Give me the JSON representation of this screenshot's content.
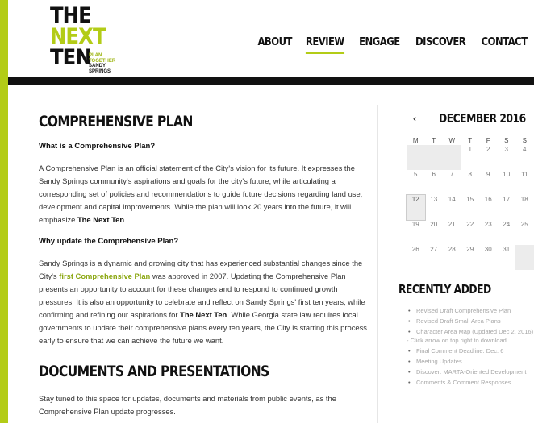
{
  "logo": {
    "line1": "THE",
    "line2": "NEXT",
    "line3": "TEN",
    "tag1": "PLAN",
    "tag2": "TOGETHER",
    "tag3": "SANDY",
    "tag4": "SPRINGS"
  },
  "nav": {
    "items": [
      {
        "label": "ABOUT"
      },
      {
        "label": "REVIEW",
        "active": true
      },
      {
        "label": "ENGAGE"
      },
      {
        "label": "DISCOVER"
      },
      {
        "label": "CONTACT"
      }
    ]
  },
  "main": {
    "title": "COMPREHENSIVE PLAN",
    "q1": "What is a Comprehensive Plan?",
    "p1_a": "A Comprehensive Plan is an official statement of the City's vision for its future. It expresses the Sandy Springs community's aspirations and goals for the city's future, while articulating a corresponding set of policies and recommendations to guide future decisions regarding land use, development and capital improvements. While the plan will look 20 years into the future, it will emphasize ",
    "p1_bold": "The Next Ten",
    "p1_end": ".",
    "q2": "Why update the Comprehensive Plan?",
    "p2_a": "Sandy Springs is a dynamic and growing city that has experienced substantial changes since the City's ",
    "p2_link": "first Comprehensive Plan",
    "p2_b": " was approved in 2007. Updating the Comprehensive Plan presents an opportunity to account for these changes and to respond to continued growth pressures. It is also an opportunity to celebrate and reflect on Sandy Springs' first ten years, while confirming and refining our aspirations for ",
    "p2_bold": "The Next Ten",
    "p2_c": ". While Georgia state law requires local governments to update their comprehensive plans every ten years, the City is starting this process early to ensure that we can achieve the future we want.",
    "title2": "DOCUMENTS AND PRESENTATIONS",
    "p3": "Stay tuned to this space for updates, documents and materials from public events, as the Comprehensive Plan update progresses."
  },
  "calendar": {
    "prev": "‹",
    "title": "DECEMBER 2016",
    "dow": [
      "M",
      "T",
      "W",
      "T",
      "F",
      "S",
      "S"
    ],
    "weeks": [
      [
        "",
        "",
        "",
        "1",
        "2",
        "3",
        "4"
      ],
      [
        "5",
        "6",
        "7",
        "8",
        "9",
        "10",
        "11"
      ],
      [
        "12",
        "13",
        "14",
        "15",
        "16",
        "17",
        "18"
      ],
      [
        "19",
        "20",
        "21",
        "22",
        "23",
        "24",
        "25"
      ],
      [
        "26",
        "27",
        "28",
        "29",
        "30",
        "31",
        ""
      ]
    ]
  },
  "recent": {
    "title": "RECENTLY ADDED",
    "items": [
      "Revised Draft Comprehensive Plan",
      "Revised Draft Small Area Plans",
      "Character Area Map (Updated Dec 2, 2016) - Click arrow on top right to download",
      "Final Comment Deadline: Dec. 6",
      "Meeting Updates",
      "Discover: MARTA-Oriented Development",
      "Comments & Comment Responses"
    ]
  }
}
